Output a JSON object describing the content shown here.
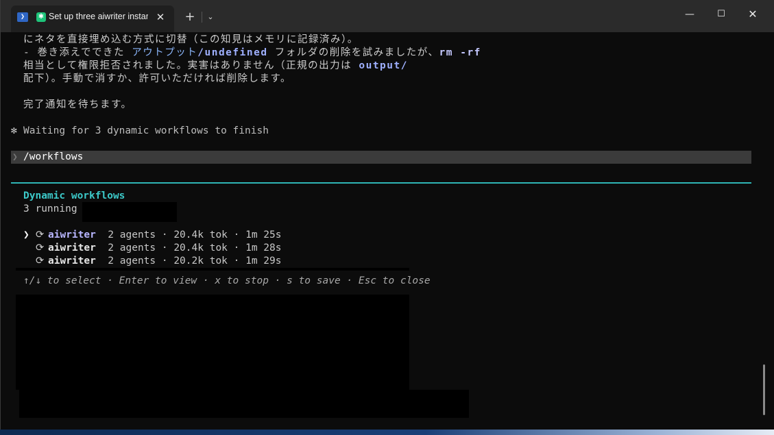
{
  "window": {
    "tab_title": "Set up three aiwriter instan",
    "tab_shell_glyph": "❯",
    "tab_app_glyph": "✱",
    "close_tab_glyph": "✕",
    "new_tab_glyph": "+",
    "dropdown_glyph": "⌄",
    "minimize_glyph": "—",
    "maximize_glyph": "☐",
    "close_glyph": "✕"
  },
  "terminal": {
    "line1": "にネタを直接埋め込む方式に切替（この知見はメモリに記録済み）。",
    "line2": {
      "prefix": "- 巻き添えでできた ",
      "link": "アウトプット",
      "path": "/undefined",
      "middle": " フォルダの削除を試みましたが、",
      "cmd": "rm -rf"
    },
    "line3": {
      "text": "相当として権限拒否されました。実害はありません（正規の出力は ",
      "path": "output/"
    },
    "line4": "配下）。手動で消すか、許可いただければ削除します。",
    "line5": "完了通知を待ちます。",
    "status_glyph": "✻",
    "status": "Waiting for 3 dynamic workflows to finish",
    "prompt_caret": "❯",
    "prompt": "/workflows",
    "panel_title": "Dynamic workflows",
    "panel_subtitle": "3 running",
    "workflows": [
      {
        "cursor": "❯",
        "spin": "⟳",
        "name": "aiwriter",
        "meta": "  2 agents · 20.4k tok · 1m 25s"
      },
      {
        "cursor": "",
        "spin": "⟳",
        "name": "aiwriter",
        "meta": "  2 agents · 20.4k tok · 1m 28s"
      },
      {
        "cursor": "",
        "spin": "⟳",
        "name": "aiwriter",
        "meta": "  2 agents · 20.2k tok · 1m 29s"
      }
    ],
    "help": "↑/↓ to select · Enter to view · x to stop · s to save · Esc to close"
  }
}
